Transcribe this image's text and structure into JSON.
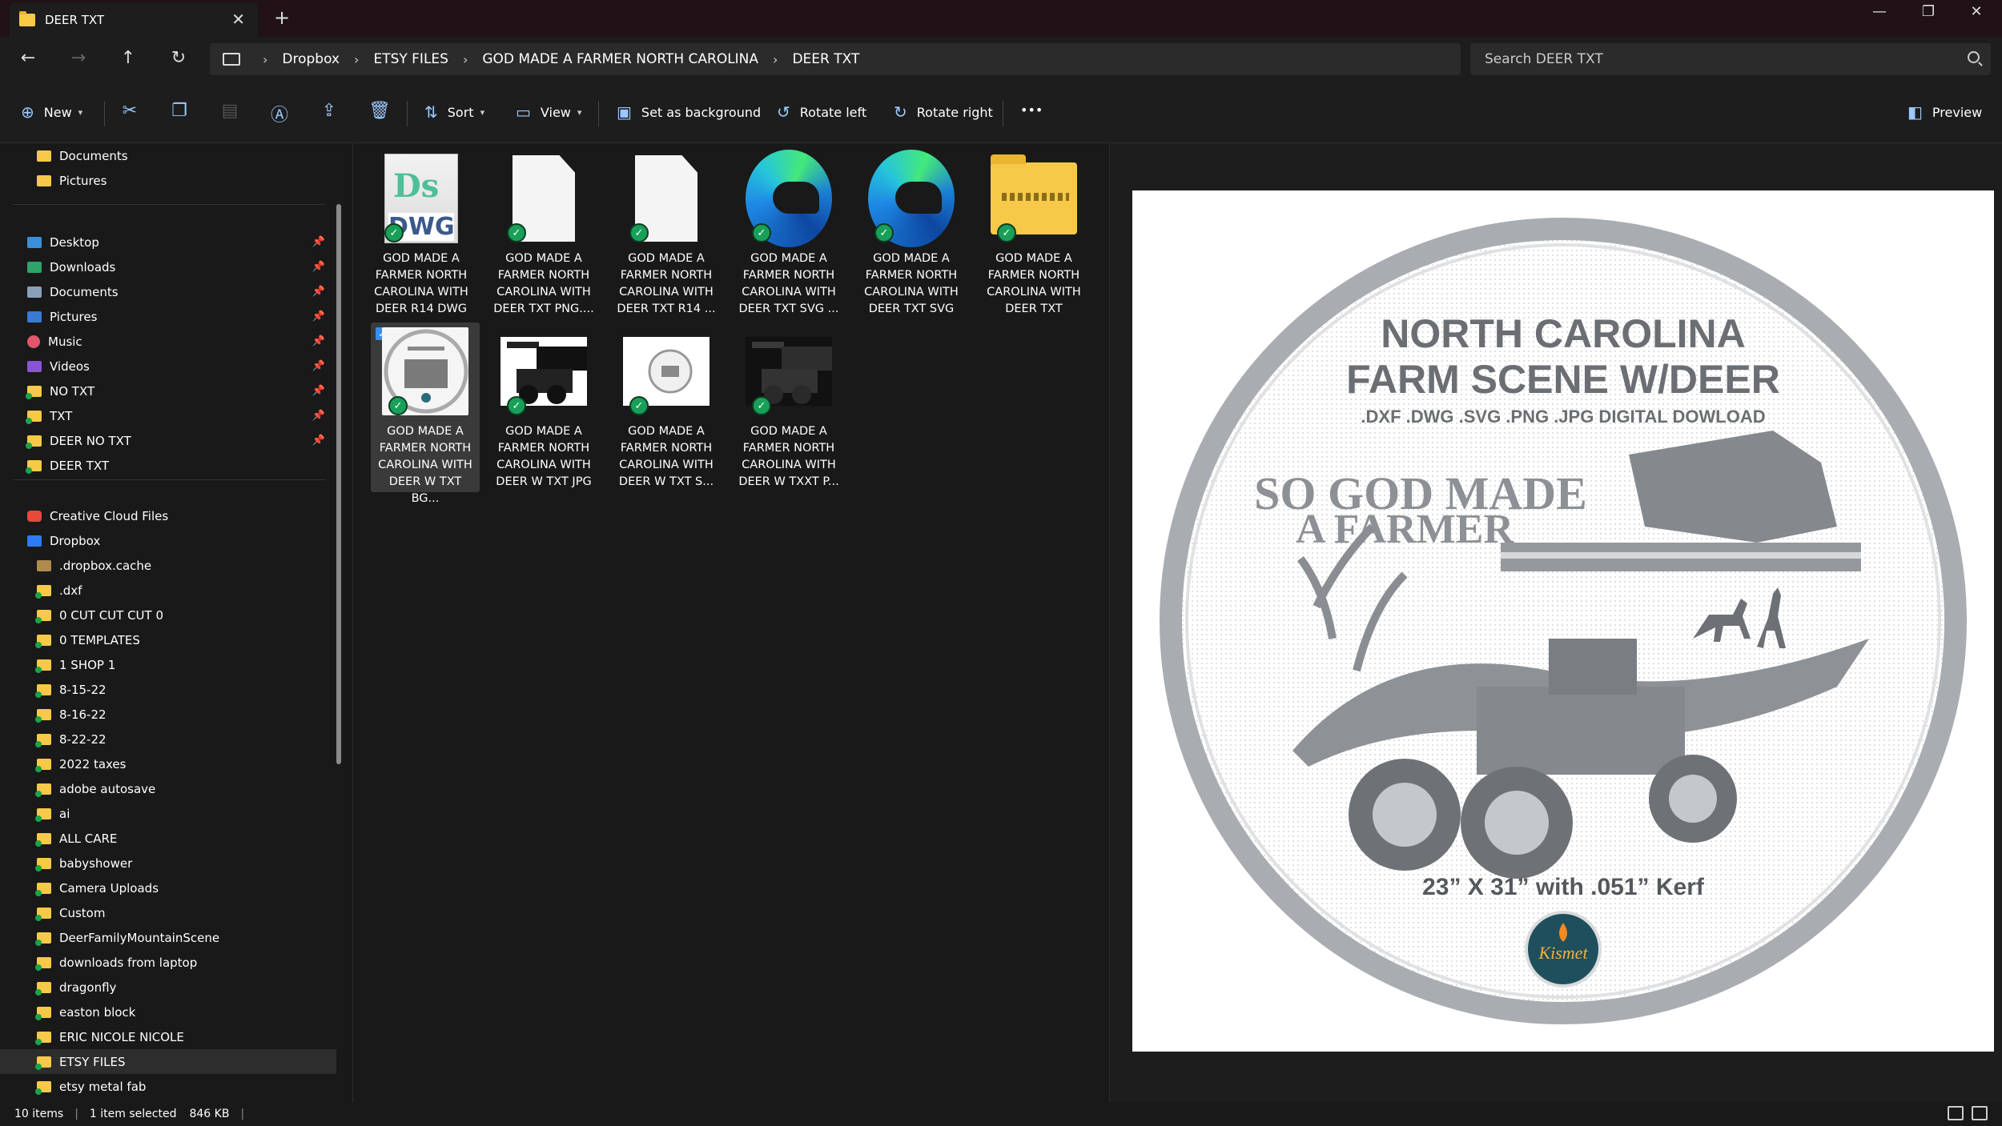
{
  "window": {
    "tab_title": "DEER TXT",
    "close_tab": "✕",
    "new_tab": "+",
    "minimize": "—",
    "maximize": "❐",
    "close": "✕"
  },
  "nav": {
    "back": "←",
    "forward": "→",
    "up": "↑",
    "refresh": "↻"
  },
  "breadcrumb": {
    "separator": "›",
    "items": [
      "Dropbox",
      "ETSY FILES",
      "GOD MADE A FARMER NORTH CAROLINA",
      "DEER TXT"
    ]
  },
  "search": {
    "placeholder": "Search DEER TXT"
  },
  "toolbar": {
    "new_label": "New",
    "sort_label": "Sort",
    "view_label": "View",
    "set_background_label": "Set as background",
    "rotate_left_label": "Rotate left",
    "rotate_right_label": "Rotate right",
    "more_label": "•••",
    "preview_label": "Preview"
  },
  "sidebar": {
    "top_items": [
      "Documents",
      "Pictures"
    ],
    "quick_access": [
      {
        "label": "Desktop",
        "icon": "desktop-icon"
      },
      {
        "label": "Downloads",
        "icon": "downloads-icon"
      },
      {
        "label": "Documents",
        "icon": "documents-icon"
      },
      {
        "label": "Pictures",
        "icon": "pictures-icon"
      },
      {
        "label": "Music",
        "icon": "music-icon"
      },
      {
        "label": "Videos",
        "icon": "videos-icon"
      },
      {
        "label": "NO TXT",
        "icon": "folder-icon"
      },
      {
        "label": "TXT",
        "icon": "folder-icon"
      },
      {
        "label": "DEER NO TXT",
        "icon": "folder-icon"
      },
      {
        "label": "DEER TXT",
        "icon": "folder-icon"
      }
    ],
    "cloud_items": [
      "Creative Cloud Files",
      "Dropbox"
    ],
    "dropbox_children": [
      ".dropbox.cache",
      ".dxf",
      "0 CUT CUT CUT 0",
      "0 TEMPLATES",
      "1 SHOP 1",
      "8-15-22",
      "8-16-22",
      "8-22-22",
      "2022 taxes",
      "adobe autosave",
      "ai",
      "ALL CARE",
      "babyshower",
      "Camera Uploads",
      "Custom",
      "DeerFamilyMountainScene",
      "downloads from laptop",
      "dragonfly",
      "easton block",
      "ERIC NICOLE NICOLE",
      "ETSY FILES",
      "etsy metal fab"
    ],
    "selected": "ETSY FILES"
  },
  "files": [
    {
      "name_lines": [
        "GOD MADE A",
        "FARMER NORTH",
        "CAROLINA WITH",
        "DEER R14 DWG"
      ],
      "kind": "dwg"
    },
    {
      "name_lines": [
        "GOD MADE A",
        "FARMER NORTH",
        "CAROLINA WITH",
        "DEER TXT PNG...."
      ],
      "kind": "blank"
    },
    {
      "name_lines": [
        "GOD MADE A",
        "FARMER NORTH",
        "CAROLINA WITH",
        "DEER TXT R14 ..."
      ],
      "kind": "blank"
    },
    {
      "name_lines": [
        "GOD MADE A",
        "FARMER NORTH",
        "CAROLINA WITH",
        "DEER TXT SVG ..."
      ],
      "kind": "edge"
    },
    {
      "name_lines": [
        "GOD MADE A",
        "FARMER NORTH",
        "CAROLINA WITH",
        "DEER TXT SVG"
      ],
      "kind": "edge"
    },
    {
      "name_lines": [
        "GOD MADE A",
        "FARMER NORTH",
        "CAROLINA WITH",
        "DEER TXT"
      ],
      "kind": "zip"
    },
    {
      "name_lines": [
        "GOD MADE A",
        "FARMER NORTH",
        "CAROLINA WITH",
        "DEER W TXT BG..."
      ],
      "kind": "round",
      "selected": true
    },
    {
      "name_lines": [
        "GOD MADE A",
        "FARMER NORTH",
        "CAROLINA WITH",
        "DEER W TXT JPG"
      ],
      "kind": "light"
    },
    {
      "name_lines": [
        "GOD MADE A",
        "FARMER NORTH",
        "CAROLINA WITH",
        "DEER W TXT S..."
      ],
      "kind": "small"
    },
    {
      "name_lines": [
        "GOD MADE A",
        "FARMER NORTH",
        "CAROLINA WITH",
        "DEER W TXXT P..."
      ],
      "kind": "dark"
    }
  ],
  "preview_image": {
    "title_line1": "NORTH CAROLINA",
    "title_line2": "FARM SCENE W/DEER",
    "formats": ".DXF .DWG .SVG .PNG .JPG DIGITAL DOWLOAD",
    "slogan_line1": "SO GOD MADE",
    "slogan_line2": "A FARMER",
    "dimensions": "23” X 31” with .051” Kerf",
    "logo_text": "Kismet"
  },
  "status": {
    "items_count": "10 items",
    "selection": "1 item selected",
    "size": "846 KB"
  },
  "colors": {
    "accent": "#3b8eea",
    "sync_check": "#18a058",
    "folder": "#f7c948"
  }
}
